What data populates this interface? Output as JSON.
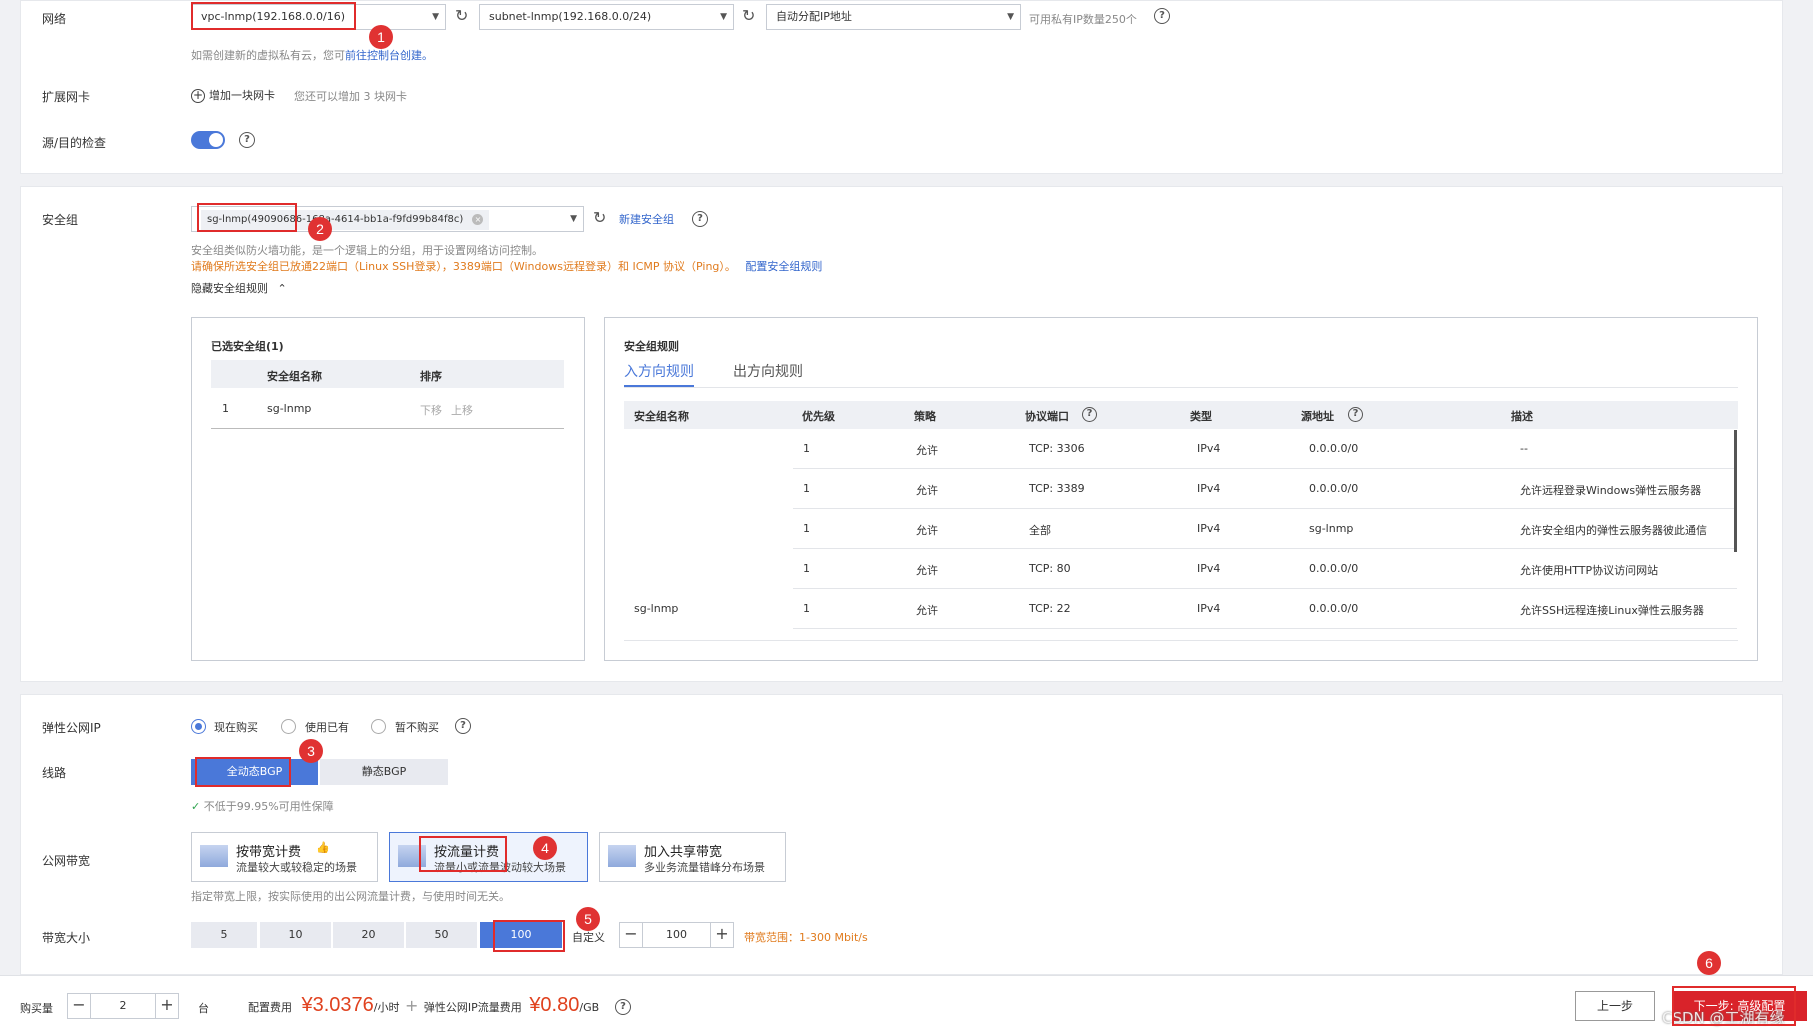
{
  "network": {
    "label": "网络",
    "vpc": "vpc-lnmp(192.168.0.0/16)",
    "subnet": "subnet-lnmp(192.168.0.0/24)",
    "ip_mode": "自动分配IP地址",
    "ip_count": "可用私有IP数量250个",
    "hint_prefix": "如需创建新的虚拟私有云，您可",
    "hint_link": "前往控制台创建。"
  },
  "ext_nic": {
    "label": "扩展网卡",
    "add": "增加一块网卡",
    "hint": "您还可以增加 3 块网卡"
  },
  "src_dst": {
    "label": "源/目的检查",
    "enabled": true
  },
  "security_group": {
    "label": "安全组",
    "selected": "sg-lnmp(49090686-168a-4614-bb1a-f9fd99b84f8c)",
    "new_link": "新建安全组",
    "desc": "安全组类似防火墙功能，是一个逻辑上的分组，用于设置网络访问控制。",
    "warning": "请确保所选安全组已放通22端口（Linux SSH登录），3389端口（Windows远程登录）和 ICMP 协议（Ping）。",
    "config_link": "配置安全组规则",
    "hide_rules": "隐藏安全组规则"
  },
  "selected_panel": {
    "title": "已选安全组(1)",
    "headers": [
      "安全组名称",
      "排序"
    ],
    "rows": [
      {
        "index": "1",
        "name": "sg-lnmp",
        "down": "下移",
        "up": "上移"
      }
    ]
  },
  "rules_panel": {
    "title": "安全组规则",
    "tabs": [
      "入方向规则",
      "出方向规则"
    ],
    "headers": [
      "安全组名称",
      "优先级",
      "策略",
      "协议端口",
      "类型",
      "源地址",
      "描述"
    ],
    "group_name": "sg-lnmp",
    "rows": [
      {
        "priority": "1",
        "policy": "允许",
        "port": "TCP: 3306",
        "type": "IPv4",
        "source": "0.0.0.0/0",
        "desc": "--"
      },
      {
        "priority": "1",
        "policy": "允许",
        "port": "TCP: 3389",
        "type": "IPv4",
        "source": "0.0.0.0/0",
        "desc": "允许远程登录Windows弹性云服务器"
      },
      {
        "priority": "1",
        "policy": "允许",
        "port": "全部",
        "type": "IPv4",
        "source": "sg-lnmp",
        "desc": "允许安全组内的弹性云服务器彼此通信"
      },
      {
        "priority": "1",
        "policy": "允许",
        "port": "TCP: 80",
        "type": "IPv4",
        "source": "0.0.0.0/0",
        "desc": "允许使用HTTP协议访问网站"
      },
      {
        "priority": "1",
        "policy": "允许",
        "port": "TCP: 22",
        "type": "IPv4",
        "source": "0.0.0.0/0",
        "desc": "允许SSH远程连接Linux弹性云服务器"
      }
    ]
  },
  "eip": {
    "label": "弹性公网IP",
    "options": [
      "现在购买",
      "使用已有",
      "暂不购买"
    ],
    "selected": "现在购买"
  },
  "line": {
    "label": "线路",
    "options": [
      "全动态BGP",
      "静态BGP"
    ],
    "selected": "全动态BGP",
    "sla": "不低于99.95%可用性保障"
  },
  "bandwidth_type": {
    "label": "公网带宽",
    "options": [
      {
        "title": "按带宽计费",
        "sub": "流量较大或较稳定的场景"
      },
      {
        "title": "按流量计费",
        "sub": "流量小或流量波动较大场景"
      },
      {
        "title": "加入共享带宽",
        "sub": "多业务流量错峰分布场景"
      }
    ],
    "selected": "按流量计费",
    "hint": "指定带宽上限，按实际使用的出公网流量计费，与使用时间无关。"
  },
  "bandwidth_size": {
    "label": "带宽大小",
    "options": [
      "5",
      "10",
      "20",
      "50",
      "100"
    ],
    "selected": "100",
    "custom_label": "自定义",
    "custom_value": "100",
    "range": "带宽范围：1-300 Mbit/s"
  },
  "footer": {
    "qty_label": "购买量",
    "qty": "2",
    "unit": "台",
    "cost_label": "配置费用",
    "cost": "¥3.0376",
    "cost_unit": "/小时",
    "plus": "+",
    "eip_label": "弹性公网IP流量费用",
    "eip_cost": "¥0.80",
    "eip_unit": "/GB",
    "prev": "上一步",
    "next": "下一步: 高级配置",
    "watermark": "CSDN @工湖有缘"
  },
  "annotations": [
    "1",
    "2",
    "3",
    "4",
    "5",
    "6"
  ],
  "colors": {
    "accent": "#4a78d9",
    "annotation": "#e02b2b",
    "price": "#e0411e",
    "warning": "#e07b1e"
  }
}
